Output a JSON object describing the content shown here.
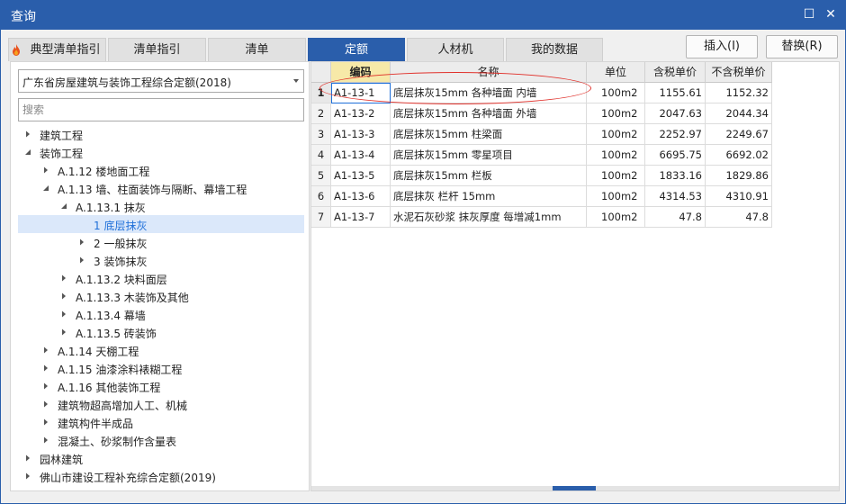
{
  "window": {
    "title": "查询",
    "restore_glyph": "☐",
    "close_glyph": "✕"
  },
  "tabs": [
    {
      "label": "典型清单指引",
      "icon": "flame-icon"
    },
    {
      "label": "清单指引"
    },
    {
      "label": "清单"
    },
    {
      "label": "定额",
      "active": true
    },
    {
      "label": "人材机"
    },
    {
      "label": "我的数据"
    }
  ],
  "actions": {
    "insert_label": "插入(I)",
    "replace_label": "替换(R)"
  },
  "left": {
    "library_select": "广东省房屋建筑与装饰工程综合定额(2018)",
    "search_placeholder": "搜索",
    "tree": [
      {
        "label": "建筑工程",
        "level": 0,
        "toggle": "collapsed"
      },
      {
        "label": "装饰工程",
        "level": 0,
        "toggle": "expanded"
      },
      {
        "label": "A.1.12 楼地面工程",
        "level": 1,
        "toggle": "collapsed"
      },
      {
        "label": "A.1.13 墙、柱面装饰与隔断、幕墙工程",
        "level": 1,
        "toggle": "expanded"
      },
      {
        "label": "A.1.13.1 抹灰",
        "level": 2,
        "toggle": "expanded"
      },
      {
        "label": "1 底层抹灰",
        "level": 3,
        "toggle": "none",
        "selected": true
      },
      {
        "label": "2 一般抹灰",
        "level": 3,
        "toggle": "collapsed"
      },
      {
        "label": "3 装饰抹灰",
        "level": 3,
        "toggle": "collapsed"
      },
      {
        "label": "A.1.13.2 块料面层",
        "level": 2,
        "toggle": "collapsed"
      },
      {
        "label": "A.1.13.3 木装饰及其他",
        "level": 2,
        "toggle": "collapsed"
      },
      {
        "label": "A.1.13.4 幕墙",
        "level": 2,
        "toggle": "collapsed"
      },
      {
        "label": "A.1.13.5 砖装饰",
        "level": 2,
        "toggle": "collapsed"
      },
      {
        "label": "A.1.14 天棚工程",
        "level": 1,
        "toggle": "collapsed"
      },
      {
        "label": "A.1.15 油漆涂料裱糊工程",
        "level": 1,
        "toggle": "collapsed"
      },
      {
        "label": "A.1.16 其他装饰工程",
        "level": 1,
        "toggle": "collapsed"
      },
      {
        "label": "建筑物超高增加人工、机械",
        "level": 1,
        "toggle": "collapsed"
      },
      {
        "label": "建筑构件半成品",
        "level": 1,
        "toggle": "collapsed"
      },
      {
        "label": "混凝土、砂浆制作含量表",
        "level": 1,
        "toggle": "collapsed"
      },
      {
        "label": "园林建筑",
        "level": 0,
        "toggle": "collapsed"
      },
      {
        "label": "佛山市建设工程补充综合定额(2019)",
        "level": 0,
        "toggle": "collapsed"
      }
    ]
  },
  "table": {
    "columns": [
      "编码",
      "名称",
      "单位",
      "含税单价",
      "不含税单价"
    ],
    "rows": [
      {
        "no": "1",
        "code": "A1-13-1",
        "name": "底层抹灰15mm 各种墙面 内墙",
        "unit": "100m2",
        "price_tax": "1155.61",
        "price_notax": "1152.32"
      },
      {
        "no": "2",
        "code": "A1-13-2",
        "name": "底层抹灰15mm 各种墙面 外墙",
        "unit": "100m2",
        "price_tax": "2047.63",
        "price_notax": "2044.34"
      },
      {
        "no": "3",
        "code": "A1-13-3",
        "name": "底层抹灰15mm 柱梁面",
        "unit": "100m2",
        "price_tax": "2252.97",
        "price_notax": "2249.67"
      },
      {
        "no": "4",
        "code": "A1-13-4",
        "name": "底层抹灰15mm 零星项目",
        "unit": "100m2",
        "price_tax": "6695.75",
        "price_notax": "6692.02"
      },
      {
        "no": "5",
        "code": "A1-13-5",
        "name": "底层抹灰15mm 栏板",
        "unit": "100m2",
        "price_tax": "1833.16",
        "price_notax": "1829.86"
      },
      {
        "no": "6",
        "code": "A1-13-6",
        "name": "底层抹灰 栏杆 15mm",
        "unit": "100m2",
        "price_tax": "4314.53",
        "price_notax": "4310.91"
      },
      {
        "no": "7",
        "code": "A1-13-7",
        "name": "水泥石灰砂浆 抹灰厚度 每增减1mm",
        "unit": "100m2",
        "price_tax": "47.8",
        "price_notax": "47.8"
      }
    ]
  },
  "colors": {
    "accent": "#2a5eab",
    "selection": "#dbe8fa",
    "highlight_ellipse": "#e0312b",
    "key_header": "#f7e9a8"
  }
}
